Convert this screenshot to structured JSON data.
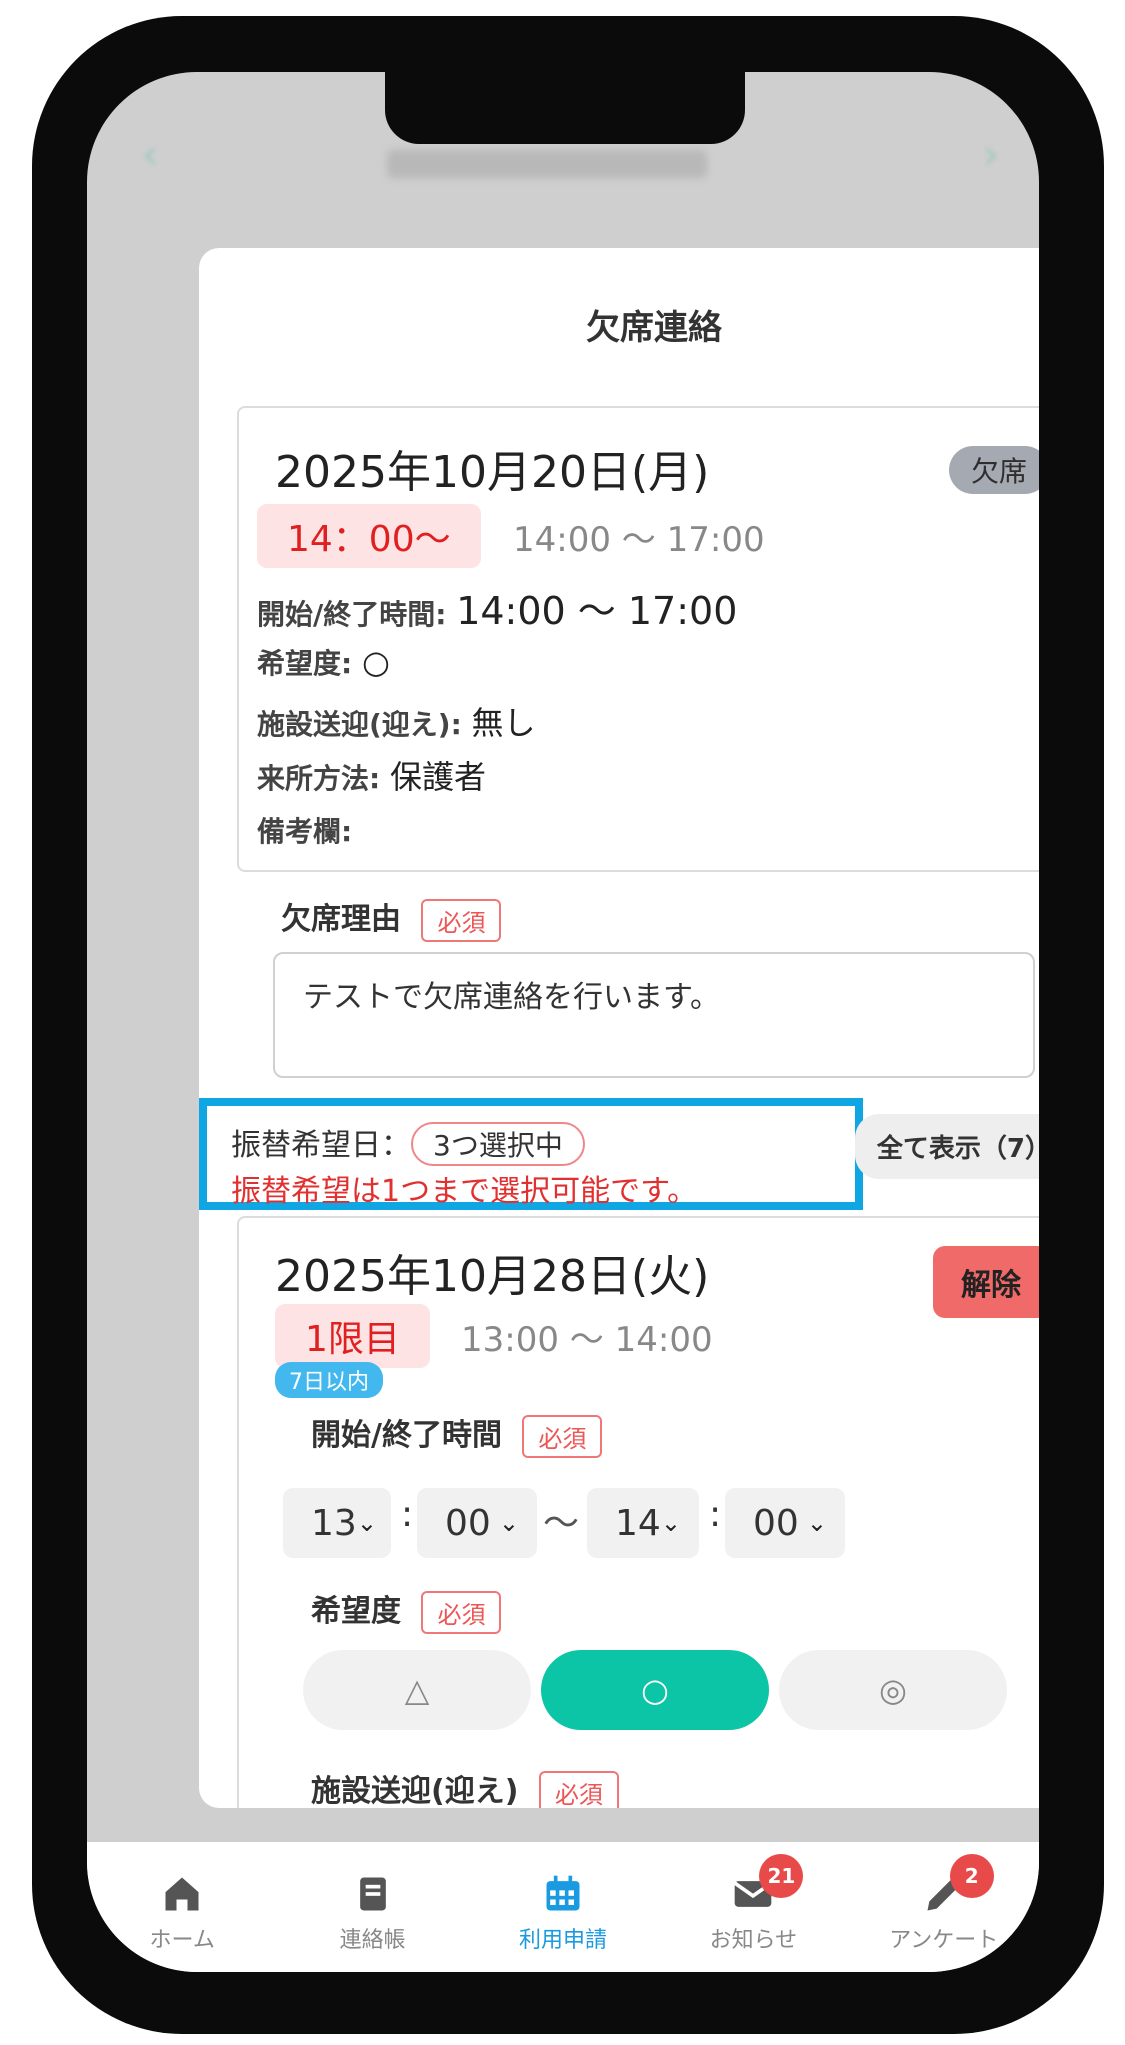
{
  "modal": {
    "title": "欠席連絡",
    "close_label": "×"
  },
  "original": {
    "date": "2025年10月20日(月)",
    "status": "欠席",
    "time_slot": "14：00〜",
    "time_range": "14:00 〜 17:00",
    "rows": {
      "start_end_label": "開始/終了時間:",
      "start_end_value": "14:00 〜 17:00",
      "preference_label": "希望度:",
      "preference_value": "○",
      "pickup_label": "施設送迎(迎え):",
      "pickup_value": "無し",
      "arrival_label": "来所方法:",
      "arrival_value": "保護者",
      "notes_label": "備考欄:",
      "notes_value": ""
    }
  },
  "reason": {
    "label": "欠席理由",
    "required": "必須",
    "value": "テストで欠席連絡を行います。"
  },
  "substitute": {
    "label": "振替希望日：",
    "selected": "3つ選択中",
    "warning": "振替希望は1つまで選択可能です。",
    "show_all": "全て表示（7）"
  },
  "sub_card": {
    "date": "2025年10月28日(火)",
    "release": "解除",
    "period": "1限目",
    "period_range": "13:00 〜 14:00",
    "within_badge": "7日以内",
    "start_end_label": "開始/終了時間",
    "required": "必須",
    "start_hour": "13",
    "start_min": "00",
    "end_hour": "14",
    "end_min": "00",
    "colon": ":",
    "tilde": "〜",
    "preference_label": "希望度",
    "preference_options": [
      "△",
      "○",
      "◎"
    ],
    "preference_selected": "○",
    "pickup_label": "施設送迎(迎え)"
  },
  "nav": [
    {
      "label": "ホーム",
      "icon": "home-icon",
      "badge": ""
    },
    {
      "label": "連絡帳",
      "icon": "book-icon",
      "badge": ""
    },
    {
      "label": "利用申請",
      "icon": "calendar-icon",
      "badge": "",
      "active": true
    },
    {
      "label": "お知らせ",
      "icon": "mail-icon",
      "badge": "21"
    },
    {
      "label": "アンケート",
      "icon": "pencil-icon",
      "badge": "2"
    }
  ],
  "colors": {
    "accent": "#0bc5a6",
    "highlight": "#10a6e4",
    "danger": "#f06a6a",
    "nav_active": "#1a9ae0"
  }
}
